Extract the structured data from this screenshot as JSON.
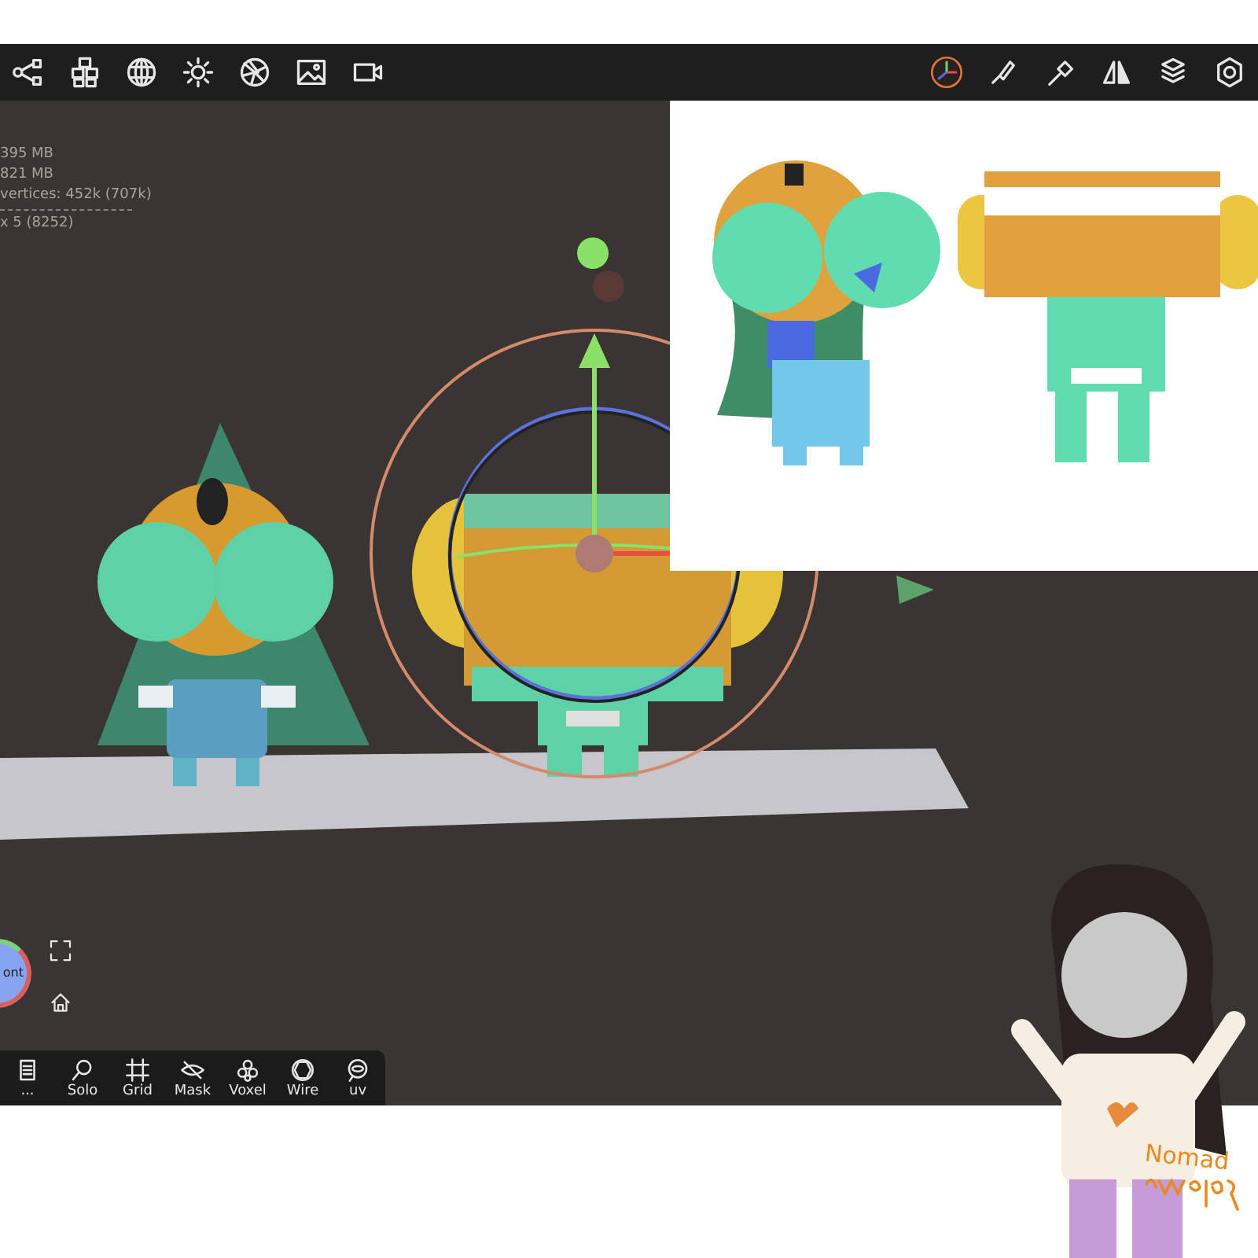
{
  "stats": [
    "395 MB",
    "821 MB",
    "vertices: 452k (707k)",
    "x 5 (8252)"
  ],
  "view_cube": {
    "label": "ont"
  },
  "bottom_toolbar": [
    {
      "label": "..."
    },
    {
      "label": "Solo"
    },
    {
      "label": "Grid"
    },
    {
      "label": "Mask"
    },
    {
      "label": "Voxel"
    },
    {
      "label": "Wire"
    },
    {
      "label": "uv"
    }
  ],
  "overlay_handwriting": "Nomad"
}
